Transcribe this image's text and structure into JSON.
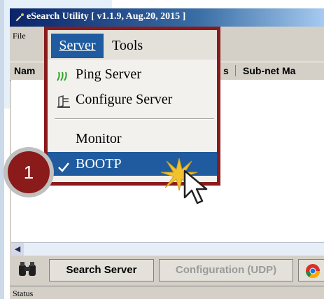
{
  "window": {
    "title": "eSearch Utility [ v1.1.9, Aug.20, 2015 ]"
  },
  "menubar": {
    "file_label": "File",
    "server_label": "Server",
    "tools_label": "Tools"
  },
  "server_menu": {
    "items": [
      {
        "label": "Ping Server",
        "icon": "ping-icon"
      },
      {
        "label": "Configure Server",
        "icon": "configure-icon"
      },
      {
        "label": "Monitor",
        "icon": ""
      },
      {
        "label": "BOOTP",
        "icon": "check-icon",
        "checked": true
      }
    ]
  },
  "list": {
    "columns": [
      "Nam",
      "s",
      "Sub-net Ma"
    ]
  },
  "buttons": {
    "search_server": "Search Server",
    "configuration_udp": "Configuration (UDP)"
  },
  "status": {
    "label": "Status"
  },
  "callout": {
    "number": "1"
  },
  "colors": {
    "accent": "#1f5b9e",
    "frame": "#8b1a1a",
    "window_bg": "#d4d0c8"
  }
}
